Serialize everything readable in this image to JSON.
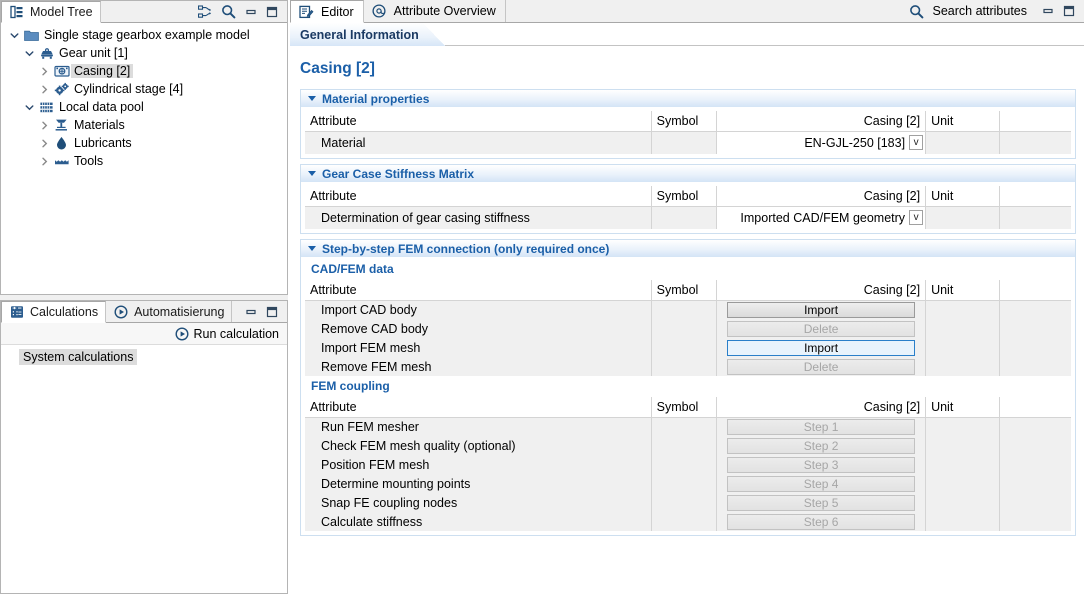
{
  "model_tree_panel": {
    "tab_label": "Model Tree",
    "tab_icon": "tree-icon",
    "tools": [
      {
        "name": "link-with-editor-icon",
        "label": "Link with Editor"
      },
      {
        "name": "search-icon",
        "label": "Search"
      },
      {
        "name": "minimize-icon",
        "label": "Minimize"
      },
      {
        "name": "maximize-icon",
        "label": "Maximize"
      }
    ],
    "tree": [
      {
        "label": "Single stage gearbox example model",
        "depth": 0,
        "twist": "down",
        "icon": "folder-icon",
        "selected": false
      },
      {
        "label": "Gear unit [1]",
        "depth": 1,
        "twist": "down",
        "icon": "gear-unit-icon",
        "selected": false
      },
      {
        "label": "Casing [2]",
        "depth": 2,
        "twist": "right",
        "icon": "casing-icon",
        "selected": true
      },
      {
        "label": "Cylindrical stage [4]",
        "depth": 2,
        "twist": "right",
        "icon": "gears-icon",
        "selected": false
      },
      {
        "label": "Local data pool",
        "depth": 1,
        "twist": "down",
        "icon": "database-icon",
        "selected": false
      },
      {
        "label": "Materials",
        "depth": 2,
        "twist": "right",
        "icon": "materials-icon",
        "selected": false
      },
      {
        "label": "Lubricants",
        "depth": 2,
        "twist": "right",
        "icon": "droplet-icon",
        "selected": false
      },
      {
        "label": "Tools",
        "depth": 2,
        "twist": "right",
        "icon": "tools-icon",
        "selected": false
      }
    ]
  },
  "calculations_panel": {
    "tabs": [
      {
        "label": "Calculations",
        "icon": "calculator-icon",
        "active": true
      },
      {
        "label": "Automatisierung",
        "icon": "play-circle-icon",
        "active": false
      }
    ],
    "tools": [
      {
        "name": "minimize-icon",
        "label": "Minimize"
      },
      {
        "name": "maximize-icon",
        "label": "Maximize"
      }
    ],
    "run_button": {
      "label": "Run calculation",
      "icon": "play-circle-icon"
    },
    "items": [
      {
        "label": "System calculations",
        "selected": true
      }
    ]
  },
  "editor": {
    "tabs": [
      {
        "label": "Editor",
        "icon": "editor-icon",
        "active": true
      },
      {
        "label": "Attribute Overview",
        "icon": "at-sign-icon",
        "active": false
      }
    ],
    "search_attributes": {
      "label": "Search attributes",
      "icon": "search-icon"
    },
    "tools": [
      {
        "name": "minimize-icon",
        "label": "Minimize"
      },
      {
        "name": "maximize-icon",
        "label": "Maximize"
      }
    ],
    "sub_tab": "General Information",
    "page_title": "Casing [2]",
    "column_headers": {
      "attribute": "Attribute",
      "symbol": "Symbol",
      "value": "Casing [2]",
      "unit": "Unit",
      "extra": ""
    },
    "sections": [
      {
        "title": "Material properties",
        "expanded": true,
        "rows": [
          {
            "attribute": "Material",
            "symbol": "",
            "value": "EN-GJL-250 [183]",
            "control": "combo",
            "unit": ""
          }
        ]
      },
      {
        "title": "Gear Case Stiffness Matrix",
        "expanded": true,
        "rows": [
          {
            "attribute": "Determination of gear casing stiffness",
            "symbol": "",
            "value": "Imported CAD/FEM geometry",
            "control": "combo",
            "unit": ""
          }
        ]
      },
      {
        "title": "Step-by-step FEM connection (only required once)",
        "expanded": true,
        "groups": [
          {
            "title": "CAD/FEM data",
            "rows": [
              {
                "attribute": "Import CAD body",
                "symbol": "",
                "button": "Import",
                "state": "normal",
                "unit": ""
              },
              {
                "attribute": "Remove CAD body",
                "symbol": "",
                "button": "Delete",
                "state": "disabled",
                "unit": ""
              },
              {
                "attribute": "Import FEM mesh",
                "symbol": "",
                "button": "Import",
                "state": "focused",
                "unit": ""
              },
              {
                "attribute": "Remove FEM mesh",
                "symbol": "",
                "button": "Delete",
                "state": "disabled",
                "unit": ""
              }
            ]
          },
          {
            "title": "FEM coupling",
            "rows": [
              {
                "attribute": "Run FEM mesher",
                "symbol": "",
                "button": "Step 1",
                "state": "disabled",
                "unit": ""
              },
              {
                "attribute": "Check FEM mesh quality (optional)",
                "symbol": "",
                "button": "Step 2",
                "state": "disabled",
                "unit": ""
              },
              {
                "attribute": "Position FEM mesh",
                "symbol": "",
                "button": "Step 3",
                "state": "disabled",
                "unit": ""
              },
              {
                "attribute": "Determine mounting points",
                "symbol": "",
                "button": "Step 4",
                "state": "disabled",
                "unit": ""
              },
              {
                "attribute": "Snap FE coupling nodes",
                "symbol": "",
                "button": "Step 5",
                "state": "disabled",
                "unit": ""
              },
              {
                "attribute": "Calculate stiffness",
                "symbol": "",
                "button": "Step 6",
                "state": "disabled",
                "unit": ""
              }
            ]
          }
        ]
      }
    ]
  },
  "colors": {
    "accent_blue": "#1b5fa8",
    "header_gradient_end": "#d3e4f6",
    "focus_blue": "#2a7fc9",
    "selection_gray": "#dcdcdc",
    "row_gray": "#f0f0f0"
  }
}
